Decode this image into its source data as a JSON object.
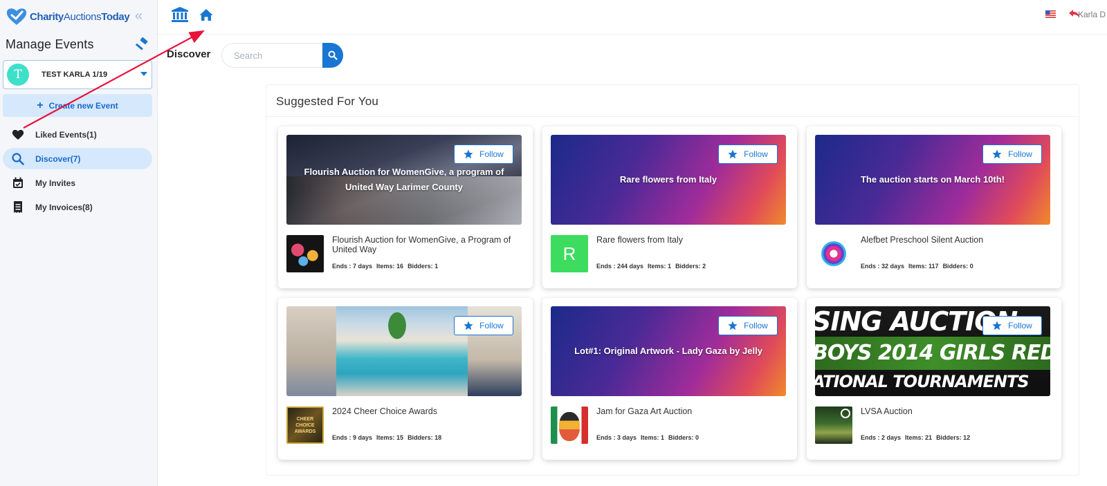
{
  "app": {
    "logo_bold": "Charity",
    "logo_light": "Auctions",
    "logo_bold2": "Today"
  },
  "sidebar": {
    "manage_title": "Manage Events",
    "event_select": {
      "avatar_letter": "T",
      "name": "TEST KARLA 1/19"
    },
    "create_label": "Create new Event",
    "items": [
      {
        "label": "Liked Events(1)",
        "icon": "heart-icon",
        "active": false
      },
      {
        "label": "Discover(7)",
        "icon": "search-icon",
        "active": true
      },
      {
        "label": "My Invites",
        "icon": "calendar-check-icon",
        "active": false
      },
      {
        "label": "My Invoices(8)",
        "icon": "receipt-icon",
        "active": false
      }
    ]
  },
  "topbar": {
    "user_name": "Karla D"
  },
  "discover": {
    "label": "Discover",
    "search_placeholder": "Search"
  },
  "panel": {
    "title": "Suggested For You",
    "follow_label": "Follow",
    "cards": [
      {
        "image_text": "Flourish Auction for WomenGive, a program of United Way Larimer County",
        "title": "Flourish Auction for WomenGive, a Program of United Way",
        "ends": "Ends : 7 days",
        "items": "Items: 16",
        "bidders": "Bidders: 1"
      },
      {
        "image_text": "Rare flowers from Italy",
        "title": "Rare flowers from Italy",
        "thumb_letter": "R",
        "ends": "Ends : 244 days",
        "items": "Items: 1",
        "bidders": "Bidders: 2"
      },
      {
        "image_text": "The auction starts on March 10th!",
        "title": "Alefbet Preschool Silent Auction",
        "ends": "Ends : 32 days",
        "items": "Items: 117",
        "bidders": "Bidders: 0"
      },
      {
        "image_text": "",
        "title": "2024 Cheer Choice Awards",
        "thumb_text": "CHEER CHOICE AWARDS",
        "ends": "Ends : 9 days",
        "items": "Items: 15",
        "bidders": "Bidders: 18"
      },
      {
        "image_text": "Lot#1: Original Artwork - Lady Gaza by Jelly",
        "title": "Jam for Gaza Art Auction",
        "ends": "Ends : 3 days",
        "items": "Items: 1",
        "bidders": "Bidders: 0"
      },
      {
        "image_lines": [
          "SING AUCTION",
          "BOYS  2014 GIRLS RED",
          "ATIONAL TOURNAMENTS"
        ],
        "title": "LVSA Auction",
        "ends": "Ends : 2 days",
        "items": "Items: 21",
        "bidders": "Bidders: 12"
      }
    ]
  },
  "colors": {
    "accent": "#1976d2",
    "active_bg": "#d6e8fb",
    "avatar": "#3ee0c8",
    "thumb_green": "#3ddc5f",
    "annotation_arrow": "#e8123c"
  }
}
